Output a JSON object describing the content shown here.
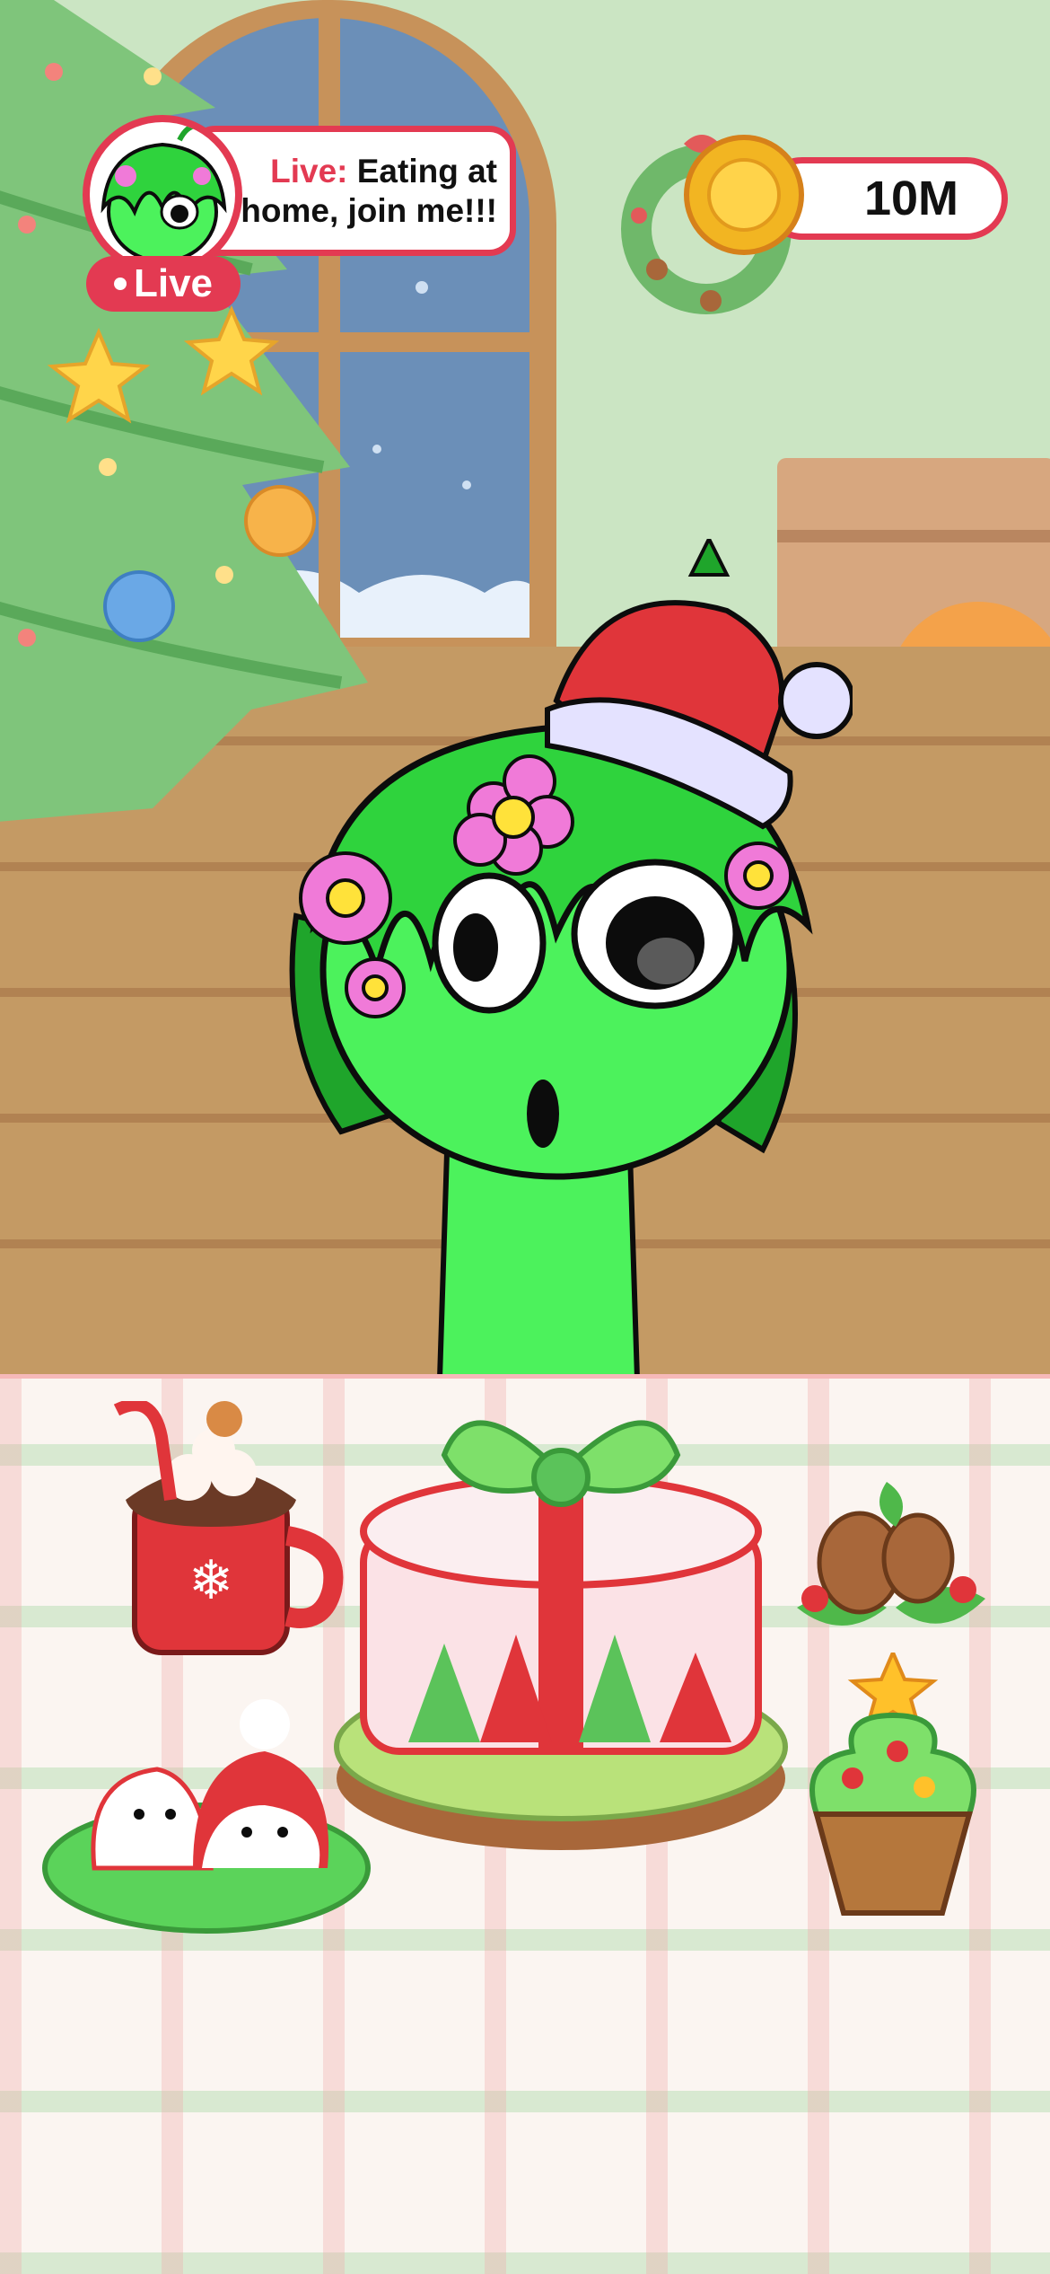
{
  "live": {
    "badge": "Live",
    "bubble_prefix": "Live:",
    "bubble_text_line1": " Eating at",
    "bubble_text_line2": "home, join me!!!"
  },
  "wallet": {
    "coins": "10M",
    "icon": "coin-icon"
  },
  "colors": {
    "accent_red": "#e33a52",
    "character_green": "#4cf25c",
    "wall": "#cbe5c3",
    "floor": "#c49a64"
  },
  "scene": {
    "character": "green-character-with-santa-hat",
    "foods": [
      "hot-cocoa-mug",
      "christmas-gift-cake",
      "pinecone-holly",
      "snowman-meringues",
      "christmas-tree-cupcake"
    ]
  }
}
